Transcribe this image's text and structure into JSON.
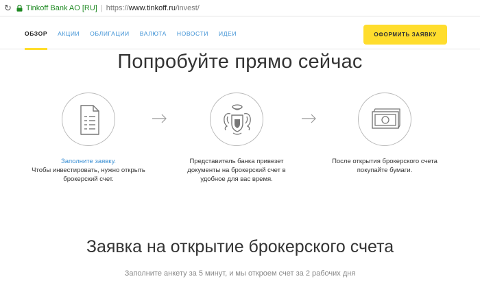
{
  "address_bar": {
    "organization": "Tinkoff Bank AO [RU]",
    "scheme": "https://",
    "host": "www.tinkoff.ru",
    "path": "/invest/"
  },
  "nav": {
    "tabs": [
      {
        "label": "ОБЗОР",
        "active": true
      },
      {
        "label": "АКЦИИ",
        "active": false
      },
      {
        "label": "ОБЛИГАЦИИ",
        "active": false
      },
      {
        "label": "ВАЛЮТА",
        "active": false
      },
      {
        "label": "НОВОСТИ",
        "active": false
      },
      {
        "label": "ИДЕИ",
        "active": false
      }
    ],
    "cta_label": "ОФОРМИТЬ ЗАЯВКУ"
  },
  "hero": {
    "title": "Попробуйте прямо сейчас"
  },
  "steps": [
    {
      "icon": "document-icon",
      "link_text": "Заполните заявку.",
      "text": "Чтобы инвестировать, нужно открыть брокерский счет."
    },
    {
      "icon": "bank-emblem-icon",
      "text": "Представитель банка привезет документы на брокерский счет в удобное для вас время."
    },
    {
      "icon": "banknote-icon",
      "text": "После открытия брокерского счета покупайте бумаги."
    }
  ],
  "form_section": {
    "title": "Заявка на открытие брокерского счета",
    "subtitle": "Заполните анкету за 5 минут, и мы откроем счет за 2 рабочих дня"
  },
  "colors": {
    "accent_yellow": "#ffdd2d",
    "link_blue": "#3a8fd4",
    "secure_green": "#208a24"
  }
}
